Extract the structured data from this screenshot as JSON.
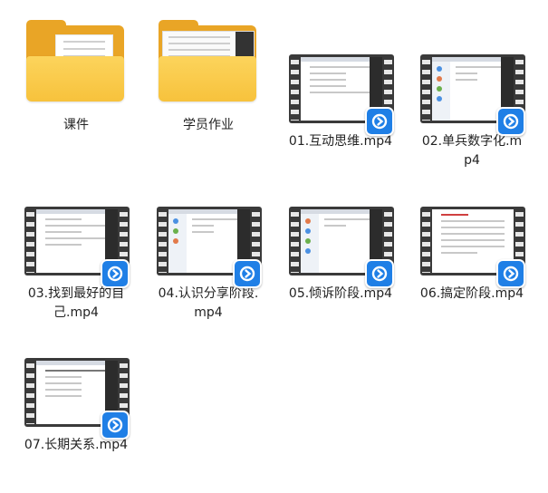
{
  "items": [
    {
      "type": "folder",
      "label": "课件",
      "icon": "folder-icon"
    },
    {
      "type": "folder",
      "label": "学员作业",
      "icon": "folder-icon"
    },
    {
      "type": "video",
      "label": "01.互动思维.mp4",
      "icon": "video-file-icon"
    },
    {
      "type": "video",
      "label": "02.单兵数字化.mp4",
      "icon": "video-file-icon"
    },
    {
      "type": "video",
      "label": "03.找到最好的自己.mp4",
      "icon": "video-file-icon"
    },
    {
      "type": "video",
      "label": "04.认识分享阶段.mp4",
      "icon": "video-file-icon"
    },
    {
      "type": "video",
      "label": "05.倾诉阶段.mp4",
      "icon": "video-file-icon"
    },
    {
      "type": "video",
      "label": "06.搞定阶段.mp4",
      "icon": "video-file-icon"
    },
    {
      "type": "video",
      "label": "07.长期关系.mp4",
      "icon": "video-file-icon"
    }
  ],
  "colors": {
    "folder": "#f7c23c",
    "badge": "#1f7fe6"
  }
}
